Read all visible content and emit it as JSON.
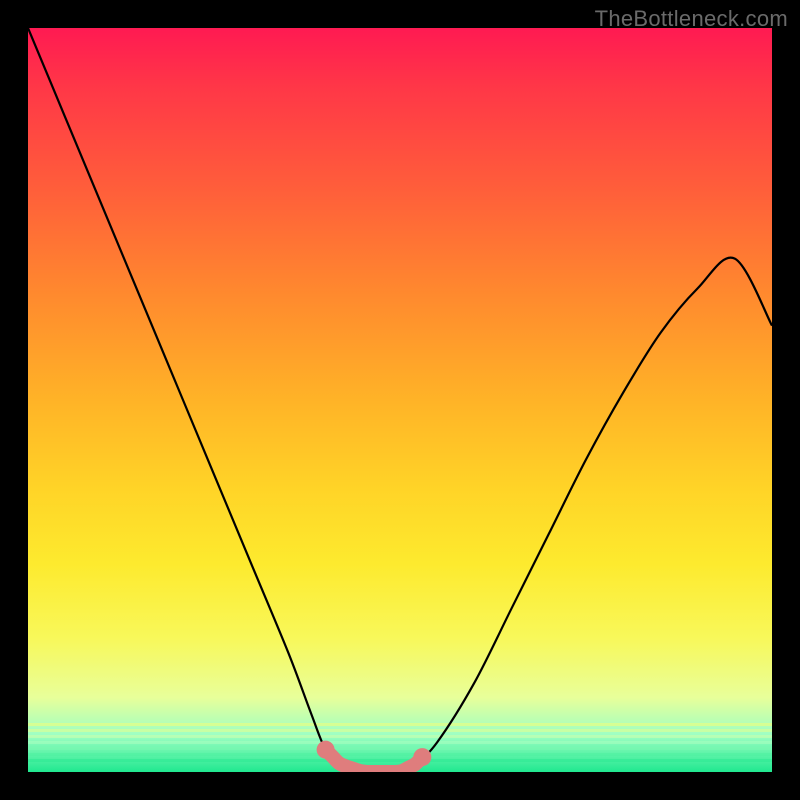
{
  "watermark": "TheBottleneck.com",
  "chart_data": {
    "type": "line",
    "title": "",
    "xlabel": "",
    "ylabel": "",
    "xlim": [
      0,
      100
    ],
    "ylim": [
      0,
      100
    ],
    "series": [
      {
        "name": "bottleneck-curve",
        "x": [
          0,
          5,
          10,
          15,
          20,
          25,
          30,
          35,
          38,
          40,
          42,
          45,
          48,
          50,
          52,
          55,
          60,
          65,
          70,
          75,
          80,
          85,
          90,
          95,
          100
        ],
        "values": [
          100,
          88,
          76,
          64,
          52,
          40,
          28,
          16,
          8,
          3,
          1,
          0,
          0,
          0,
          1,
          4,
          12,
          22,
          32,
          42,
          51,
          59,
          65,
          69,
          60
        ]
      }
    ],
    "annotations": [
      {
        "name": "valley-highlight",
        "x_start": 40,
        "x_end": 53,
        "color": "#e07b7b"
      }
    ],
    "background_gradient": {
      "stops": [
        {
          "pos": 0,
          "color": "#ff1a52"
        },
        {
          "pos": 50,
          "color": "#ffb327"
        },
        {
          "pos": 82,
          "color": "#f8f85a"
        },
        {
          "pos": 100,
          "color": "#20e890"
        }
      ]
    }
  }
}
